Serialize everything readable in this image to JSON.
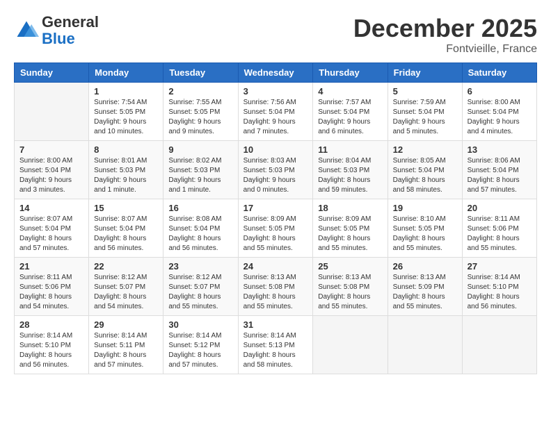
{
  "logo": {
    "general": "General",
    "blue": "Blue"
  },
  "header": {
    "month_year": "December 2025",
    "location": "Fontvieille, France"
  },
  "weekdays": [
    "Sunday",
    "Monday",
    "Tuesday",
    "Wednesday",
    "Thursday",
    "Friday",
    "Saturday"
  ],
  "weeks": [
    [
      {
        "day": "",
        "sunrise": "",
        "sunset": "",
        "daylight": ""
      },
      {
        "day": "1",
        "sunrise": "Sunrise: 7:54 AM",
        "sunset": "Sunset: 5:05 PM",
        "daylight": "Daylight: 9 hours and 10 minutes."
      },
      {
        "day": "2",
        "sunrise": "Sunrise: 7:55 AM",
        "sunset": "Sunset: 5:05 PM",
        "daylight": "Daylight: 9 hours and 9 minutes."
      },
      {
        "day": "3",
        "sunrise": "Sunrise: 7:56 AM",
        "sunset": "Sunset: 5:04 PM",
        "daylight": "Daylight: 9 hours and 7 minutes."
      },
      {
        "day": "4",
        "sunrise": "Sunrise: 7:57 AM",
        "sunset": "Sunset: 5:04 PM",
        "daylight": "Daylight: 9 hours and 6 minutes."
      },
      {
        "day": "5",
        "sunrise": "Sunrise: 7:59 AM",
        "sunset": "Sunset: 5:04 PM",
        "daylight": "Daylight: 9 hours and 5 minutes."
      },
      {
        "day": "6",
        "sunrise": "Sunrise: 8:00 AM",
        "sunset": "Sunset: 5:04 PM",
        "daylight": "Daylight: 9 hours and 4 minutes."
      }
    ],
    [
      {
        "day": "7",
        "sunrise": "Sunrise: 8:00 AM",
        "sunset": "Sunset: 5:04 PM",
        "daylight": "Daylight: 9 hours and 3 minutes."
      },
      {
        "day": "8",
        "sunrise": "Sunrise: 8:01 AM",
        "sunset": "Sunset: 5:03 PM",
        "daylight": "Daylight: 9 hours and 1 minute."
      },
      {
        "day": "9",
        "sunrise": "Sunrise: 8:02 AM",
        "sunset": "Sunset: 5:03 PM",
        "daylight": "Daylight: 9 hours and 1 minute."
      },
      {
        "day": "10",
        "sunrise": "Sunrise: 8:03 AM",
        "sunset": "Sunset: 5:03 PM",
        "daylight": "Daylight: 9 hours and 0 minutes."
      },
      {
        "day": "11",
        "sunrise": "Sunrise: 8:04 AM",
        "sunset": "Sunset: 5:03 PM",
        "daylight": "Daylight: 8 hours and 59 minutes."
      },
      {
        "day": "12",
        "sunrise": "Sunrise: 8:05 AM",
        "sunset": "Sunset: 5:04 PM",
        "daylight": "Daylight: 8 hours and 58 minutes."
      },
      {
        "day": "13",
        "sunrise": "Sunrise: 8:06 AM",
        "sunset": "Sunset: 5:04 PM",
        "daylight": "Daylight: 8 hours and 57 minutes."
      }
    ],
    [
      {
        "day": "14",
        "sunrise": "Sunrise: 8:07 AM",
        "sunset": "Sunset: 5:04 PM",
        "daylight": "Daylight: 8 hours and 57 minutes."
      },
      {
        "day": "15",
        "sunrise": "Sunrise: 8:07 AM",
        "sunset": "Sunset: 5:04 PM",
        "daylight": "Daylight: 8 hours and 56 minutes."
      },
      {
        "day": "16",
        "sunrise": "Sunrise: 8:08 AM",
        "sunset": "Sunset: 5:04 PM",
        "daylight": "Daylight: 8 hours and 56 minutes."
      },
      {
        "day": "17",
        "sunrise": "Sunrise: 8:09 AM",
        "sunset": "Sunset: 5:05 PM",
        "daylight": "Daylight: 8 hours and 55 minutes."
      },
      {
        "day": "18",
        "sunrise": "Sunrise: 8:09 AM",
        "sunset": "Sunset: 5:05 PM",
        "daylight": "Daylight: 8 hours and 55 minutes."
      },
      {
        "day": "19",
        "sunrise": "Sunrise: 8:10 AM",
        "sunset": "Sunset: 5:05 PM",
        "daylight": "Daylight: 8 hours and 55 minutes."
      },
      {
        "day": "20",
        "sunrise": "Sunrise: 8:11 AM",
        "sunset": "Sunset: 5:06 PM",
        "daylight": "Daylight: 8 hours and 55 minutes."
      }
    ],
    [
      {
        "day": "21",
        "sunrise": "Sunrise: 8:11 AM",
        "sunset": "Sunset: 5:06 PM",
        "daylight": "Daylight: 8 hours and 54 minutes."
      },
      {
        "day": "22",
        "sunrise": "Sunrise: 8:12 AM",
        "sunset": "Sunset: 5:07 PM",
        "daylight": "Daylight: 8 hours and 54 minutes."
      },
      {
        "day": "23",
        "sunrise": "Sunrise: 8:12 AM",
        "sunset": "Sunset: 5:07 PM",
        "daylight": "Daylight: 8 hours and 55 minutes."
      },
      {
        "day": "24",
        "sunrise": "Sunrise: 8:13 AM",
        "sunset": "Sunset: 5:08 PM",
        "daylight": "Daylight: 8 hours and 55 minutes."
      },
      {
        "day": "25",
        "sunrise": "Sunrise: 8:13 AM",
        "sunset": "Sunset: 5:08 PM",
        "daylight": "Daylight: 8 hours and 55 minutes."
      },
      {
        "day": "26",
        "sunrise": "Sunrise: 8:13 AM",
        "sunset": "Sunset: 5:09 PM",
        "daylight": "Daylight: 8 hours and 55 minutes."
      },
      {
        "day": "27",
        "sunrise": "Sunrise: 8:14 AM",
        "sunset": "Sunset: 5:10 PM",
        "daylight": "Daylight: 8 hours and 56 minutes."
      }
    ],
    [
      {
        "day": "28",
        "sunrise": "Sunrise: 8:14 AM",
        "sunset": "Sunset: 5:10 PM",
        "daylight": "Daylight: 8 hours and 56 minutes."
      },
      {
        "day": "29",
        "sunrise": "Sunrise: 8:14 AM",
        "sunset": "Sunset: 5:11 PM",
        "daylight": "Daylight: 8 hours and 57 minutes."
      },
      {
        "day": "30",
        "sunrise": "Sunrise: 8:14 AM",
        "sunset": "Sunset: 5:12 PM",
        "daylight": "Daylight: 8 hours and 57 minutes."
      },
      {
        "day": "31",
        "sunrise": "Sunrise: 8:14 AM",
        "sunset": "Sunset: 5:13 PM",
        "daylight": "Daylight: 8 hours and 58 minutes."
      },
      {
        "day": "",
        "sunrise": "",
        "sunset": "",
        "daylight": ""
      },
      {
        "day": "",
        "sunrise": "",
        "sunset": "",
        "daylight": ""
      },
      {
        "day": "",
        "sunrise": "",
        "sunset": "",
        "daylight": ""
      }
    ]
  ]
}
